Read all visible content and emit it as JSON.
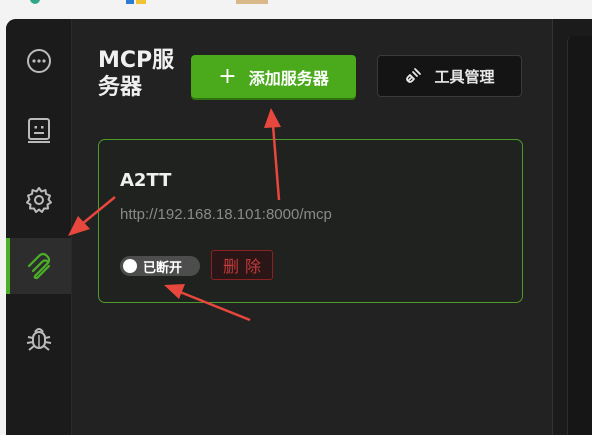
{
  "sidebar": {
    "items": [
      {
        "icon": "chat-bubble-icon"
      },
      {
        "icon": "robot-face-icon"
      },
      {
        "icon": "gear-icon"
      },
      {
        "icon": "mcp-plug-icon",
        "active": true
      },
      {
        "icon": "bug-icon"
      }
    ]
  },
  "header": {
    "title": "MCP服务器",
    "add_button_label": "添加服务器",
    "tools_button_label": "工具管理"
  },
  "server": {
    "name": "A2TT",
    "url": "http://192.168.18.101:8000/mcp",
    "status_label": "已断开",
    "delete_label": "删除"
  },
  "colors": {
    "accent_green": "#4aaa1b",
    "delete_red": "#c23a3a",
    "annotation_red": "#e8473d"
  }
}
